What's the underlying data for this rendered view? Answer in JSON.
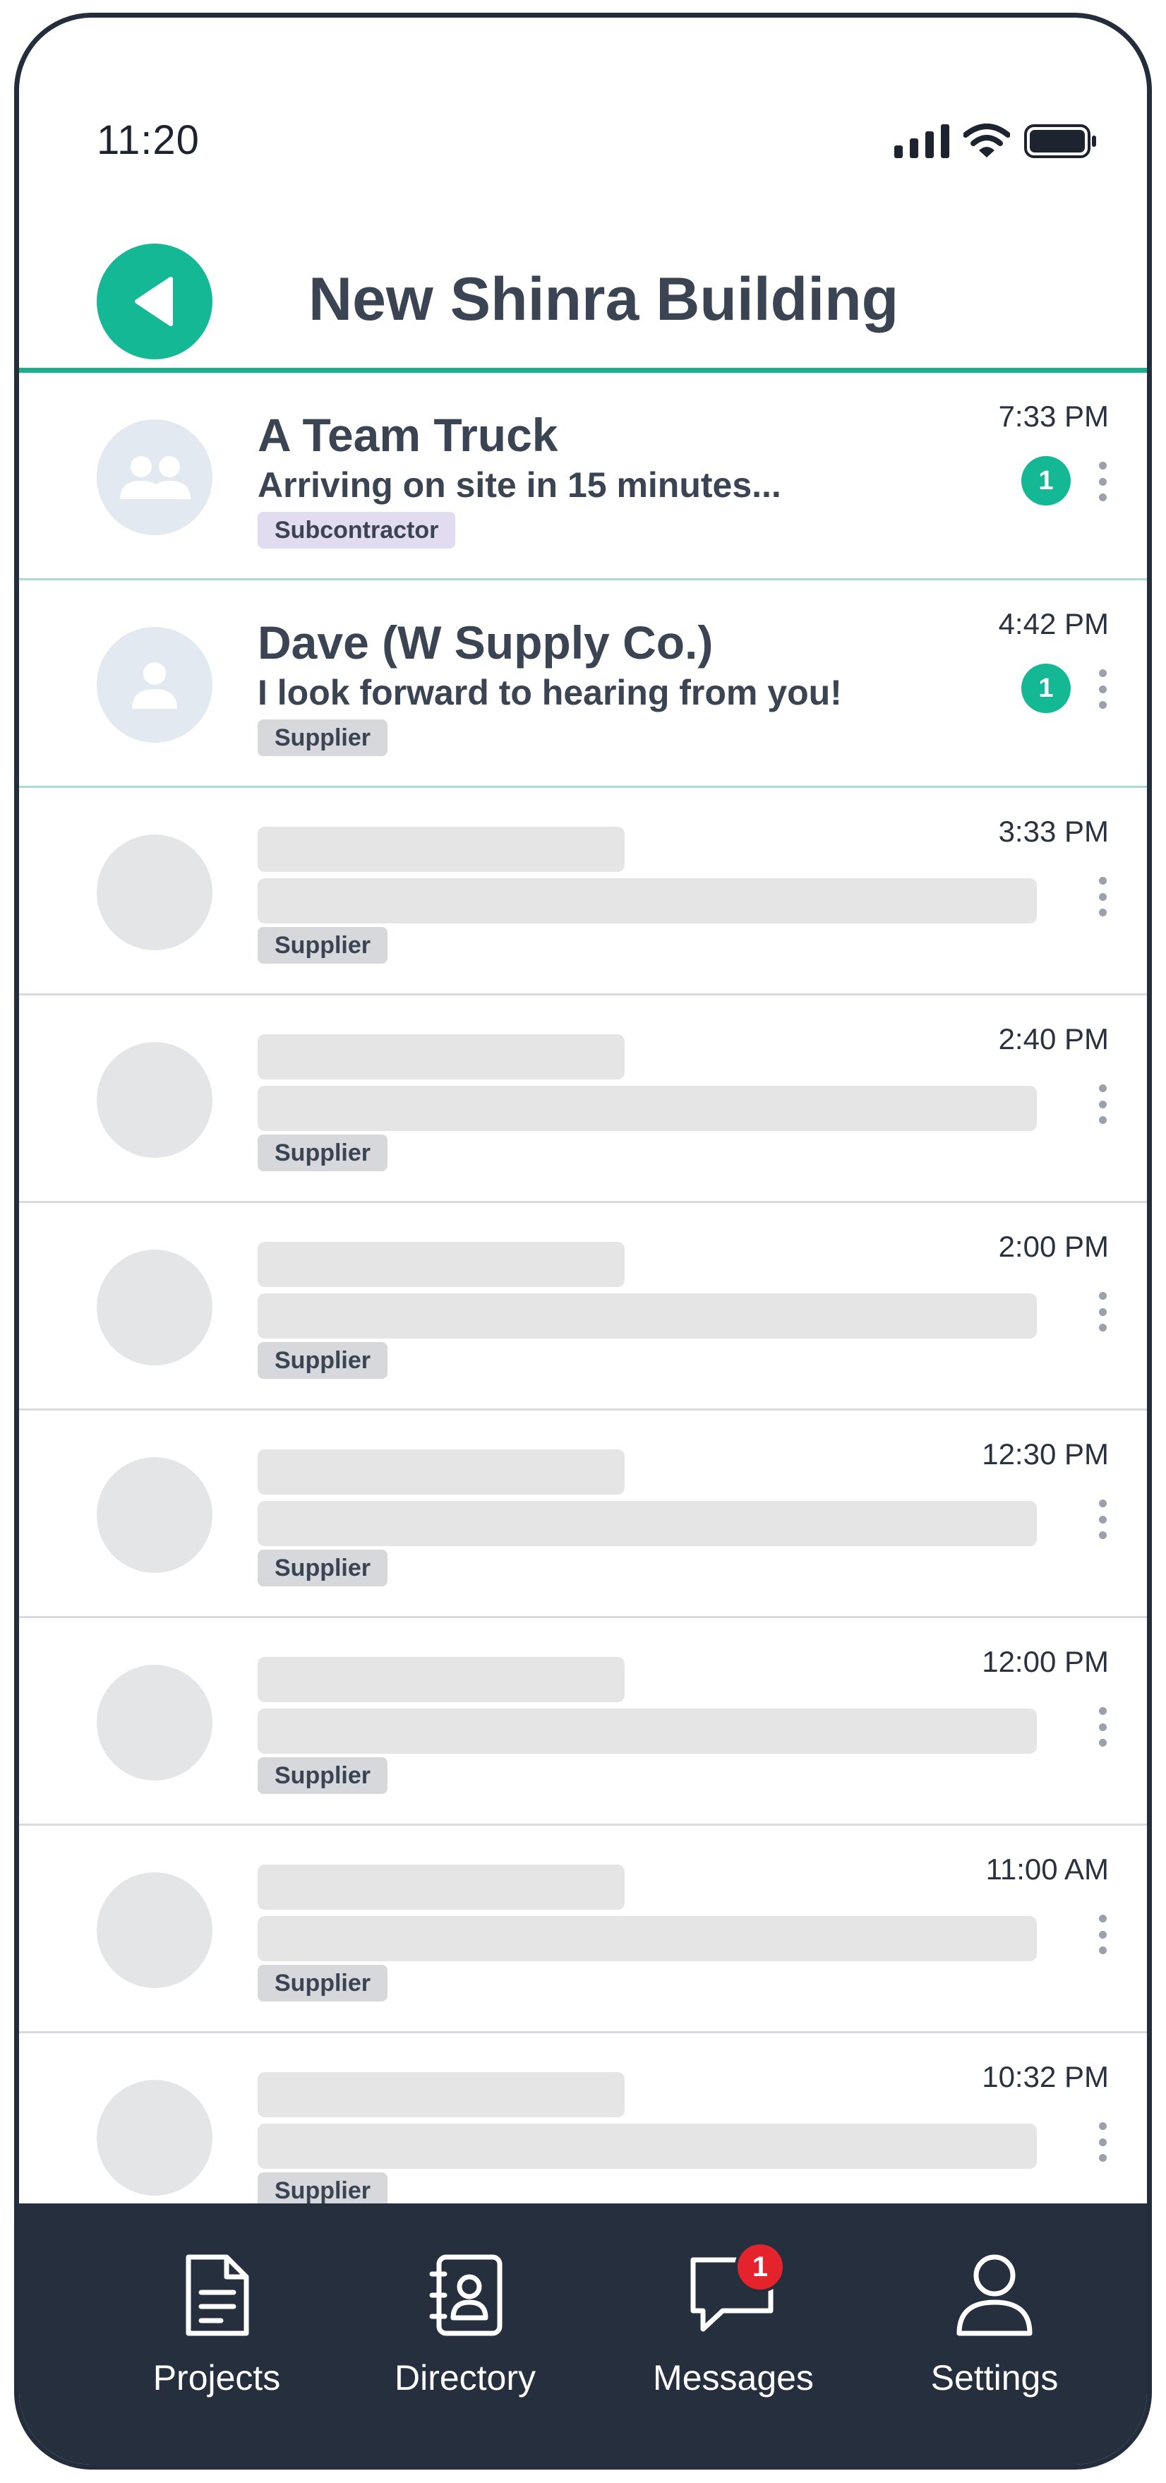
{
  "status_bar": {
    "time": "11:20",
    "icons": [
      "signal-icon",
      "wifi-icon",
      "battery-icon"
    ]
  },
  "header": {
    "title": "New Shinra Building",
    "back_icon": "back-arrow-icon",
    "accent_color": "#15b894"
  },
  "conversations": [
    {
      "name": "A Team Truck",
      "preview": "Arriving on site in 15 minutes...",
      "role": "Subcontractor",
      "time": "7:33 PM",
      "unread": "1",
      "avatar_icon": "group-icon"
    },
    {
      "name": "Dave (W Supply Co.)",
      "preview": "I look forward to hearing from you!",
      "role": "Supplier",
      "time": "4:42 PM",
      "unread": "1",
      "avatar_icon": "person-icon"
    },
    {
      "role": "Supplier",
      "time": "3:33 PM"
    },
    {
      "role": "Supplier",
      "time": "2:40 PM"
    },
    {
      "role": "Supplier",
      "time": "2:00 PM"
    },
    {
      "role": "Supplier",
      "time": "12:30 PM"
    },
    {
      "role": "Supplier",
      "time": "12:00 PM"
    },
    {
      "role": "Supplier",
      "time": "11:00 AM"
    },
    {
      "role": "Supplier",
      "time": "10:32 PM"
    }
  ],
  "bottom_nav": {
    "projects": {
      "label": "Projects",
      "icon": "document-icon"
    },
    "directory": {
      "label": "Directory",
      "icon": "address-book-icon"
    },
    "messages": {
      "label": "Messages",
      "icon": "chat-bubble-icon",
      "badge": "1"
    },
    "settings": {
      "label": "Settings",
      "icon": "user-icon"
    }
  },
  "colors": {
    "nav_background": "#252f3e",
    "unread_badge": "#15b894",
    "notification_badge": "#e5232d",
    "subcontractor_badge": "#e1dcef",
    "supplier_badge": "#d6d8db"
  }
}
